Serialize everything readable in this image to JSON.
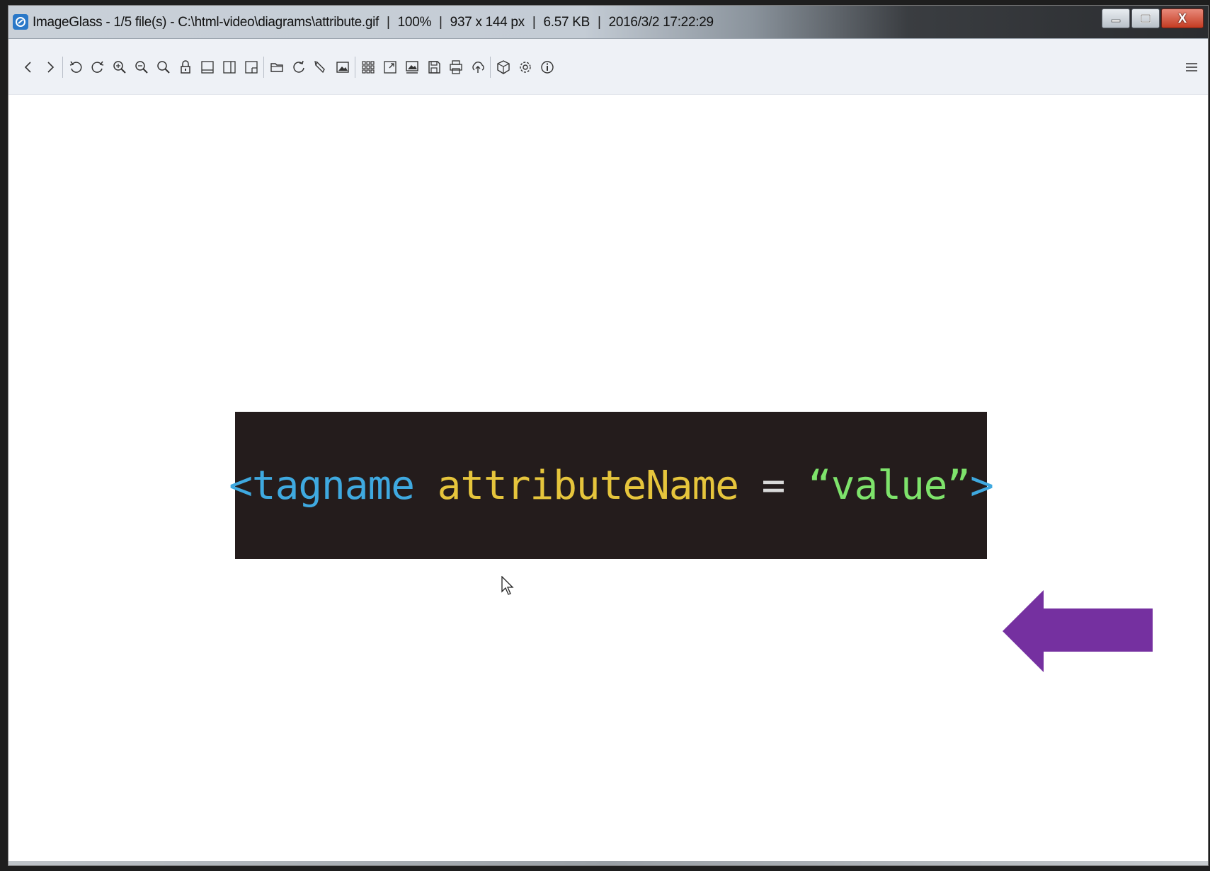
{
  "window": {
    "app_name": "ImageGlass",
    "file_index": "1/5 file(s)",
    "file_path": "C:\\html-video\\diagrams\\attribute.gif",
    "zoom": "100%",
    "dimensions": "937 x 144 px",
    "file_size": "6.57 KB",
    "modified": "2016/3/2 17:22:29",
    "controls": {
      "minimize_icon": "minimize-icon",
      "maximize_icon": "maximize-icon",
      "close_label": "X"
    }
  },
  "toolbar": {
    "groups": [
      [
        "previous-icon",
        "next-icon"
      ],
      [
        "rotate-left-icon",
        "rotate-right-icon",
        "zoom-in-icon",
        "zoom-out-icon",
        "actual-size-icon",
        "lock-zoom-icon",
        "auto-zoom-icon",
        "fit-width-icon",
        "fit-height-icon"
      ],
      [
        "open-file-icon",
        "refresh-icon",
        "edit-icon",
        "wallpaper-icon"
      ],
      [
        "thumbnail-icon",
        "fullscreen-icon",
        "slideshow-icon",
        "convert-icon",
        "print-icon",
        "upload-icon"
      ],
      [
        "extension-icon",
        "settings-icon",
        "about-icon"
      ]
    ],
    "menu_icon": "hamburger-menu-icon"
  },
  "image": {
    "code": {
      "open": "<tagname",
      "attr": "attributeName",
      "eq": "=",
      "value": "“value”",
      "close": ">"
    },
    "colors": {
      "background": "#241c1c",
      "tag": "#3fa9e0",
      "attribute": "#e6c53c",
      "equals": "#d9d9d9",
      "value": "#7ee36b",
      "arrow": "#7530a0"
    },
    "annotation_icon": "left-arrow-icon"
  }
}
